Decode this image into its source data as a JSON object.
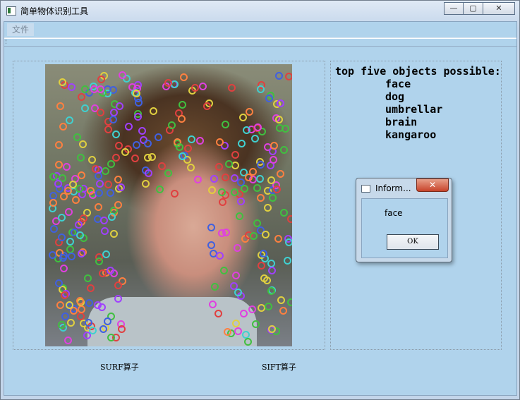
{
  "window": {
    "title": "简单物体识别工具",
    "minimize_glyph": "—",
    "maximize_glyph": "▢",
    "close_glyph": "✕"
  },
  "menubar": {
    "file_label": "文件"
  },
  "results": {
    "heading": "top five objects possible:",
    "items": [
      "face",
      "dog",
      "umbrellar",
      "brain",
      "kangaroo"
    ]
  },
  "labels": {
    "surf": "SURF算子",
    "sift": "SIFT算子"
  },
  "dialog": {
    "title": "Inform...",
    "close_glyph": "✕",
    "message": "face",
    "ok_label": "OK"
  },
  "icons": {
    "app": "app-window-icon",
    "dialog": "dialog-window-icon"
  },
  "colors": {
    "client_bg": "#b0d3ec",
    "close_red": "#c7432a",
    "keypoint_colors": [
      "#e04040",
      "#40c040",
      "#4060e0",
      "#e040e0",
      "#40d0d0",
      "#e0d040",
      "#ff8040",
      "#a040ff"
    ]
  }
}
